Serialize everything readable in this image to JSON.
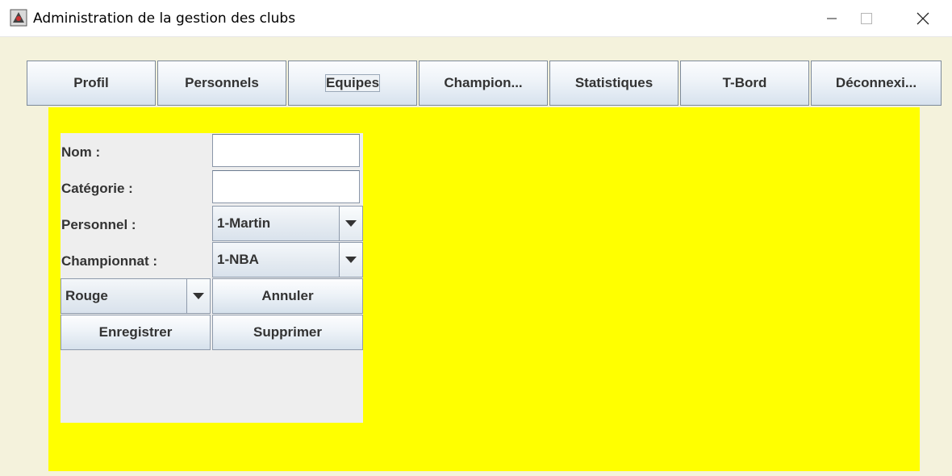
{
  "window": {
    "title": "Administration de la gestion des clubs",
    "icon": "java-app-icon",
    "controls": [
      "minimize-icon",
      "maximize-icon",
      "close-icon"
    ]
  },
  "tabs": [
    {
      "label": "Profil"
    },
    {
      "label": "Personnels"
    },
    {
      "label": "Equipes",
      "active": true
    },
    {
      "label": "Champion..."
    },
    {
      "label": "Statistiques"
    },
    {
      "label": "T-Bord"
    },
    {
      "label": "Déconnexi..."
    }
  ],
  "form": {
    "name_label": "Nom :",
    "name_value": "",
    "category_label": "Catégorie :",
    "category_value": "",
    "personnel_label": "Personnel :",
    "personnel_value": "1-Martin",
    "championship_label": "Championnat :",
    "championship_value": "1-NBA",
    "color_value": "Rouge",
    "cancel_label": "Annuler",
    "save_label": "Enregistrer",
    "delete_label": "Supprimer"
  },
  "colors": {
    "panel": "#ffff00",
    "form_bg": "#eeeeee",
    "window_bg": "#f4f2dc"
  }
}
